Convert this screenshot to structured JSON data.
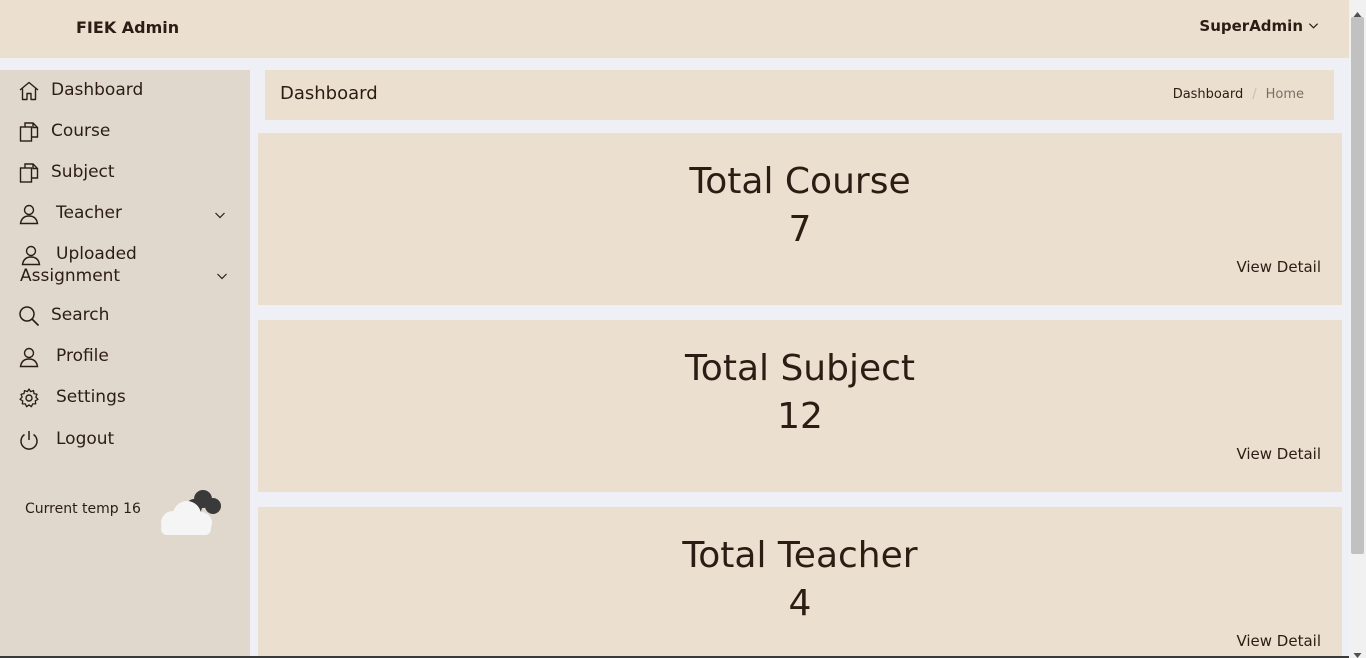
{
  "header": {
    "brand": "FIEK Admin",
    "user_label": "SuperAdmin",
    "user_icon": "chevron-down-icon"
  },
  "sidebar": {
    "items": [
      {
        "label": "Dashboard",
        "icon": "home-icon"
      },
      {
        "label": "Course",
        "icon": "document-icon"
      },
      {
        "label": "Subject",
        "icon": "document-icon"
      },
      {
        "label": "Teacher",
        "icon": "person-icon",
        "expandable": true
      },
      {
        "label": "Uploaded Assignment",
        "icon": "person-icon",
        "expandable": true
      },
      {
        "label": "Search",
        "icon": "search-icon"
      },
      {
        "label": "Profile",
        "icon": "person-icon"
      },
      {
        "label": "Settings",
        "icon": "gear-icon"
      },
      {
        "label": "Logout",
        "icon": "power-icon"
      }
    ],
    "weather": {
      "text": "Current temp 16",
      "icon": "cloud-icon"
    }
  },
  "page_header": {
    "title": "Dashboard",
    "breadcrumb": [
      {
        "label": "Dashboard"
      },
      {
        "label": "Home"
      }
    ]
  },
  "cards": [
    {
      "title": "Total Course",
      "value": "7",
      "link": "View Detail"
    },
    {
      "title": "Total Subject",
      "value": "12",
      "link": "View Detail"
    },
    {
      "title": "Total Teacher",
      "value": "4",
      "link": "View Detail"
    }
  ],
  "colors": {
    "panel": "#ebdfcf",
    "sidebar": "#e0d8cd",
    "background": "#eef0f5",
    "text": "#2b1d14"
  }
}
